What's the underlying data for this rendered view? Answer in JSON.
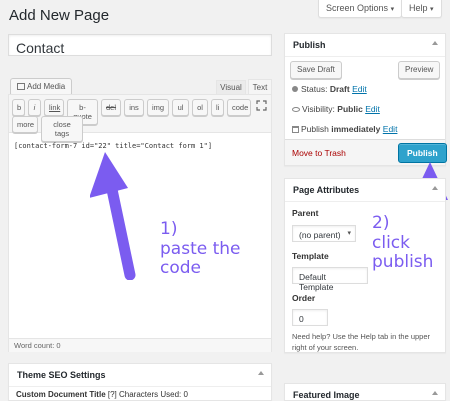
{
  "screen_options": {
    "screen_options_label": "Screen Options",
    "help_label": "Help"
  },
  "heading": "Add New Page",
  "title_value": "Contact",
  "editor": {
    "add_media_label": "Add Media",
    "tabs": [
      "Visual",
      "Text"
    ],
    "quicktags": [
      "b",
      "i",
      "link",
      "b-quote",
      "del",
      "ins",
      "img",
      "ul",
      "ol",
      "li",
      "code",
      "more",
      "close tags"
    ],
    "content": "[contact-form-7 id=\"22\" title=\"Contact form 1\"]",
    "word_count": "Word count: 0"
  },
  "annotations": {
    "step1": [
      "1)",
      "paste the",
      "code"
    ],
    "step2": [
      "2)",
      "click",
      "publish"
    ]
  },
  "publish": {
    "title": "Publish",
    "save_draft_label": "Save Draft",
    "preview_label": "Preview",
    "status_label": "Status:",
    "status_value": "Draft",
    "edit_label": "Edit",
    "visibility_label": "Visibility:",
    "visibility_value": "Public",
    "schedule_label": "Publish",
    "schedule_value": "immediately",
    "trash_label": "Move to Trash",
    "publish_label": "Publish"
  },
  "page_attributes": {
    "title": "Page Attributes",
    "parent_label": "Parent",
    "parent_value": "(no parent)",
    "template_label": "Template",
    "template_value": "Default Template",
    "order_label": "Order",
    "order_value": "0",
    "help_text": "Need help? Use the Help tab in the upper right of your screen."
  },
  "seo": {
    "title": "Theme SEO Settings",
    "field_label": "Custom Document Title",
    "field_hint": "[?] Characters Used: 0"
  },
  "featured_image": {
    "title": "Featured Image"
  },
  "colors": {
    "accent": "#2ea2cc",
    "link": "#0073aa",
    "trash": "#a00",
    "annotation": "#7b5cf0"
  }
}
